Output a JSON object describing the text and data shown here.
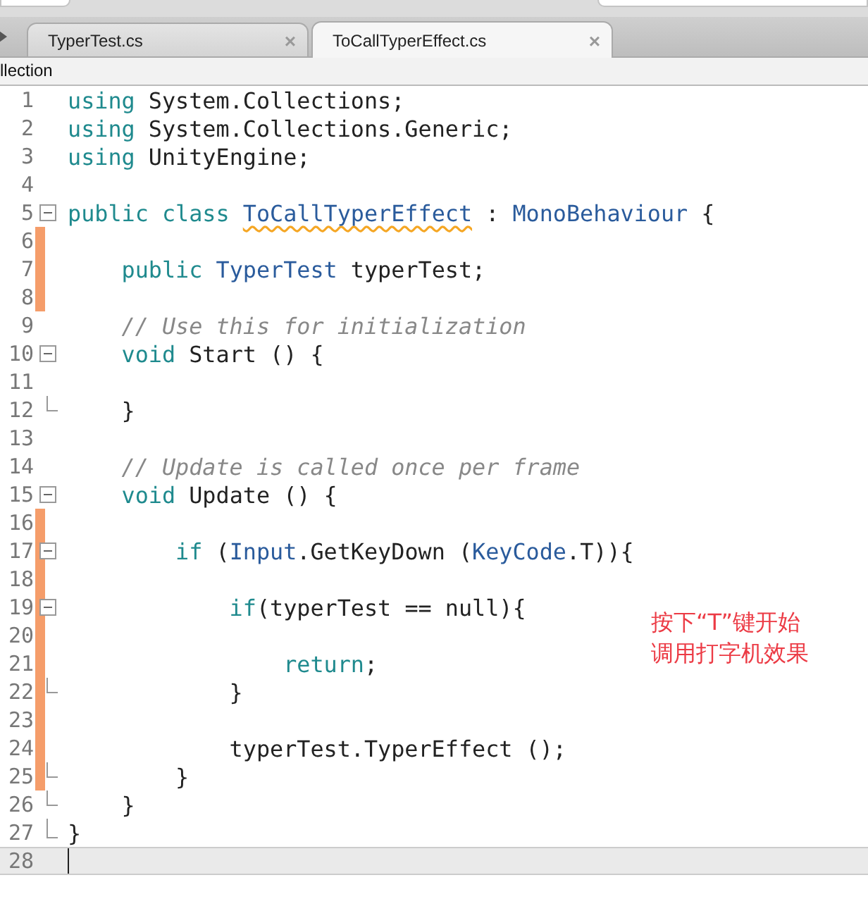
{
  "tabs": [
    {
      "label": "TyperTest.cs",
      "close": "×",
      "selected": false
    },
    {
      "label": "ToCallTyperEffect.cs",
      "close": "×",
      "selected": true
    }
  ],
  "breadcrumb": "llection",
  "lines": [
    {
      "number": "1",
      "kind": "plain",
      "changed": false,
      "current": false,
      "tokens": [
        {
          "text": "using",
          "kind": "keyword"
        },
        {
          "text": " System.Collections;",
          "kind": "plain"
        }
      ]
    },
    {
      "number": "2",
      "kind": "plain",
      "changed": false,
      "current": false,
      "tokens": [
        {
          "text": "using",
          "kind": "keyword"
        },
        {
          "text": " System.Collections.Generic;",
          "kind": "plain"
        }
      ]
    },
    {
      "number": "3",
      "kind": "plain",
      "changed": false,
      "current": false,
      "tokens": [
        {
          "text": "using",
          "kind": "keyword"
        },
        {
          "text": " UnityEngine;",
          "kind": "plain"
        }
      ]
    },
    {
      "number": "4",
      "kind": "plain",
      "changed": false,
      "current": false
    },
    {
      "number": "5",
      "kind": "fold-start",
      "changed": false,
      "current": false,
      "tokens": [
        {
          "text": "public class ",
          "kind": "keyword"
        },
        {
          "text": "ToCallTyperEffect",
          "kind": "flagged-type"
        },
        {
          "text": " : ",
          "kind": "plain"
        },
        {
          "text": "MonoBehaviour",
          "kind": "type"
        },
        {
          "text": " {",
          "kind": "plain"
        }
      ]
    },
    {
      "number": "6",
      "kind": "plain",
      "changed": true,
      "current": false
    },
    {
      "number": "7",
      "kind": "plain",
      "changed": true,
      "current": false,
      "tokens": [
        {
          "text": "    public ",
          "kind": "keyword"
        },
        {
          "text": "TyperTest",
          "kind": "type"
        },
        {
          "text": " typerTest;",
          "kind": "plain"
        }
      ]
    },
    {
      "number": "8",
      "kind": "plain",
      "changed": true,
      "current": false
    },
    {
      "number": "9",
      "kind": "plain",
      "changed": false,
      "current": false,
      "tokens": [
        {
          "text": "    // Use this for initialization",
          "kind": "comment"
        }
      ]
    },
    {
      "number": "10",
      "kind": "fold-start",
      "changed": false,
      "current": false,
      "tokens": [
        {
          "text": "    void",
          "kind": "keyword"
        },
        {
          "text": " Start () {",
          "kind": "plain"
        }
      ]
    },
    {
      "number": "11",
      "kind": "plain",
      "changed": false,
      "current": false
    },
    {
      "number": "12",
      "kind": "fold-end",
      "changed": false,
      "current": false,
      "tokens": [
        {
          "text": "    }",
          "kind": "plain"
        }
      ]
    },
    {
      "number": "13",
      "kind": "plain",
      "changed": false,
      "current": false
    },
    {
      "number": "14",
      "kind": "plain",
      "changed": false,
      "current": false,
      "tokens": [
        {
          "text": "    // Update is called once per frame",
          "kind": "comment"
        }
      ]
    },
    {
      "number": "15",
      "kind": "fold-start",
      "changed": false,
      "current": false,
      "tokens": [
        {
          "text": "    void",
          "kind": "keyword"
        },
        {
          "text": " Update () {",
          "kind": "plain"
        }
      ]
    },
    {
      "number": "16",
      "kind": "plain",
      "changed": true,
      "current": false
    },
    {
      "number": "17",
      "kind": "fold-start",
      "changed": true,
      "current": false,
      "tokens": [
        {
          "text": "        if",
          "kind": "keyword"
        },
        {
          "text": " (",
          "kind": "plain"
        },
        {
          "text": "Input",
          "kind": "type"
        },
        {
          "text": ".GetKeyDown (",
          "kind": "plain"
        },
        {
          "text": "KeyCode",
          "kind": "type"
        },
        {
          "text": ".T)){",
          "kind": "plain"
        }
      ]
    },
    {
      "number": "18",
      "kind": "plain",
      "changed": true,
      "current": false
    },
    {
      "number": "19",
      "kind": "fold-start",
      "changed": true,
      "current": false,
      "tokens": [
        {
          "text": "            if",
          "kind": "keyword"
        },
        {
          "text": "(typerTest == null){",
          "kind": "plain"
        }
      ]
    },
    {
      "number": "20",
      "kind": "plain",
      "changed": true,
      "current": false
    },
    {
      "number": "21",
      "kind": "plain",
      "changed": true,
      "current": false,
      "tokens": [
        {
          "text": "                return",
          "kind": "keyword"
        },
        {
          "text": ";",
          "kind": "plain"
        }
      ]
    },
    {
      "number": "22",
      "kind": "fold-end",
      "changed": true,
      "current": false,
      "tokens": [
        {
          "text": "            }",
          "kind": "plain"
        }
      ]
    },
    {
      "number": "23",
      "kind": "plain",
      "changed": true,
      "current": false
    },
    {
      "number": "24",
      "kind": "plain",
      "changed": true,
      "current": false,
      "tokens": [
        {
          "text": "            typerTest.TyperEffect ();",
          "kind": "plain"
        }
      ]
    },
    {
      "number": "25",
      "kind": "fold-end",
      "changed": true,
      "current": false,
      "tokens": [
        {
          "text": "        }",
          "kind": "plain"
        }
      ]
    },
    {
      "number": "26",
      "kind": "fold-end",
      "changed": false,
      "current": false,
      "tokens": [
        {
          "text": "    }",
          "kind": "plain"
        }
      ]
    },
    {
      "number": "27",
      "kind": "fold-last",
      "changed": false,
      "current": false,
      "tokens": [
        {
          "text": "}",
          "kind": "plain"
        }
      ]
    },
    {
      "number": "28",
      "kind": "plain",
      "changed": false,
      "current": true
    }
  ],
  "annotation": [
    "按下“T”键开始",
    "调用打字机效果"
  ]
}
